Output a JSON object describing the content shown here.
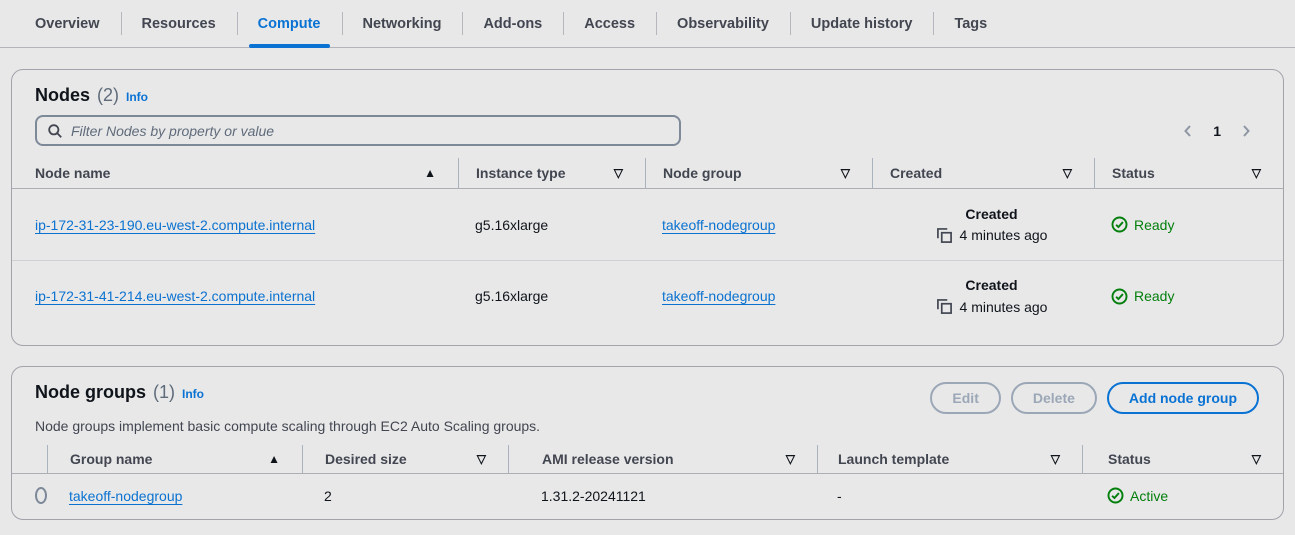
{
  "tabs": {
    "items": [
      {
        "label": "Overview",
        "active": false
      },
      {
        "label": "Resources",
        "active": false
      },
      {
        "label": "Compute",
        "active": true
      },
      {
        "label": "Networking",
        "active": false
      },
      {
        "label": "Add-ons",
        "active": false
      },
      {
        "label": "Access",
        "active": false
      },
      {
        "label": "Observability",
        "active": false
      },
      {
        "label": "Update history",
        "active": false
      },
      {
        "label": "Tags",
        "active": false
      }
    ]
  },
  "icons": {
    "sort_ascending": "▲",
    "sort_descending": "▽"
  },
  "colors": {
    "accent_blue": "#0972d3",
    "link_blue": "#0b72d0",
    "status_green": "#037f0c"
  },
  "nodes_section": {
    "title": "Nodes",
    "count": "(2)",
    "info_label": "Info",
    "filter": {
      "placeholder": "Filter Nodes by property or value"
    },
    "pagination": {
      "current_page": "1"
    },
    "columns": [
      {
        "label": "Node name",
        "sorted": "ascending"
      },
      {
        "label": "Instance type",
        "sorted": "none"
      },
      {
        "label": "Node group",
        "sorted": "none"
      },
      {
        "label": "Created",
        "sorted": "none"
      },
      {
        "label": "Status",
        "sorted": "none"
      }
    ],
    "rows": [
      {
        "node_name": "ip-172-31-23-190.eu-west-2.compute.internal",
        "instance_type": "g5.16xlarge",
        "node_group": "takeoff-nodegroup",
        "created_label": "Created",
        "created": "4 minutes ago",
        "status": "Ready"
      },
      {
        "node_name": "ip-172-31-41-214.eu-west-2.compute.internal",
        "instance_type": "g5.16xlarge",
        "node_group": "takeoff-nodegroup",
        "created_label": "Created",
        "created": "4 minutes ago",
        "status": "Ready"
      }
    ]
  },
  "node_groups_section": {
    "title": "Node groups",
    "count": "(1)",
    "info_label": "Info",
    "description": "Node groups implement basic compute scaling through EC2 Auto Scaling groups.",
    "buttons": {
      "edit": "Edit",
      "delete": "Delete",
      "add": "Add node group"
    },
    "columns": [
      {
        "label": "Group name",
        "sorted": "ascending"
      },
      {
        "label": "Desired size",
        "sorted": "none"
      },
      {
        "label": "AMI release version",
        "sorted": "none"
      },
      {
        "label": "Launch template",
        "sorted": "none"
      },
      {
        "label": "Status",
        "sorted": "none"
      }
    ],
    "rows": [
      {
        "group_name": "takeoff-nodegroup",
        "desired_size": "2",
        "ami_release_version": "1.31.2-20241121",
        "launch_template": "-",
        "status": "Active"
      }
    ]
  }
}
